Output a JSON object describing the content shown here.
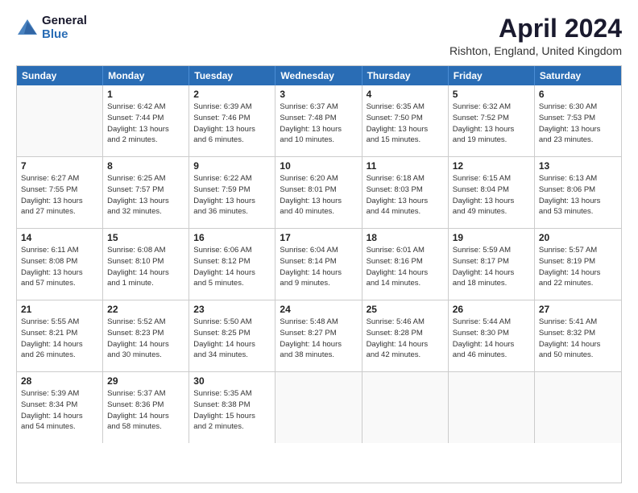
{
  "logo": {
    "general": "General",
    "blue": "Blue"
  },
  "title": "April 2024",
  "location": "Rishton, England, United Kingdom",
  "days_of_week": [
    "Sunday",
    "Monday",
    "Tuesday",
    "Wednesday",
    "Thursday",
    "Friday",
    "Saturday"
  ],
  "weeks": [
    [
      {
        "day": "",
        "info": ""
      },
      {
        "day": "1",
        "info": "Sunrise: 6:42 AM\nSunset: 7:44 PM\nDaylight: 13 hours\nand 2 minutes."
      },
      {
        "day": "2",
        "info": "Sunrise: 6:39 AM\nSunset: 7:46 PM\nDaylight: 13 hours\nand 6 minutes."
      },
      {
        "day": "3",
        "info": "Sunrise: 6:37 AM\nSunset: 7:48 PM\nDaylight: 13 hours\nand 10 minutes."
      },
      {
        "day": "4",
        "info": "Sunrise: 6:35 AM\nSunset: 7:50 PM\nDaylight: 13 hours\nand 15 minutes."
      },
      {
        "day": "5",
        "info": "Sunrise: 6:32 AM\nSunset: 7:52 PM\nDaylight: 13 hours\nand 19 minutes."
      },
      {
        "day": "6",
        "info": "Sunrise: 6:30 AM\nSunset: 7:53 PM\nDaylight: 13 hours\nand 23 minutes."
      }
    ],
    [
      {
        "day": "7",
        "info": "Sunrise: 6:27 AM\nSunset: 7:55 PM\nDaylight: 13 hours\nand 27 minutes."
      },
      {
        "day": "8",
        "info": "Sunrise: 6:25 AM\nSunset: 7:57 PM\nDaylight: 13 hours\nand 32 minutes."
      },
      {
        "day": "9",
        "info": "Sunrise: 6:22 AM\nSunset: 7:59 PM\nDaylight: 13 hours\nand 36 minutes."
      },
      {
        "day": "10",
        "info": "Sunrise: 6:20 AM\nSunset: 8:01 PM\nDaylight: 13 hours\nand 40 minutes."
      },
      {
        "day": "11",
        "info": "Sunrise: 6:18 AM\nSunset: 8:03 PM\nDaylight: 13 hours\nand 44 minutes."
      },
      {
        "day": "12",
        "info": "Sunrise: 6:15 AM\nSunset: 8:04 PM\nDaylight: 13 hours\nand 49 minutes."
      },
      {
        "day": "13",
        "info": "Sunrise: 6:13 AM\nSunset: 8:06 PM\nDaylight: 13 hours\nand 53 minutes."
      }
    ],
    [
      {
        "day": "14",
        "info": "Sunrise: 6:11 AM\nSunset: 8:08 PM\nDaylight: 13 hours\nand 57 minutes."
      },
      {
        "day": "15",
        "info": "Sunrise: 6:08 AM\nSunset: 8:10 PM\nDaylight: 14 hours\nand 1 minute."
      },
      {
        "day": "16",
        "info": "Sunrise: 6:06 AM\nSunset: 8:12 PM\nDaylight: 14 hours\nand 5 minutes."
      },
      {
        "day": "17",
        "info": "Sunrise: 6:04 AM\nSunset: 8:14 PM\nDaylight: 14 hours\nand 9 minutes."
      },
      {
        "day": "18",
        "info": "Sunrise: 6:01 AM\nSunset: 8:16 PM\nDaylight: 14 hours\nand 14 minutes."
      },
      {
        "day": "19",
        "info": "Sunrise: 5:59 AM\nSunset: 8:17 PM\nDaylight: 14 hours\nand 18 minutes."
      },
      {
        "day": "20",
        "info": "Sunrise: 5:57 AM\nSunset: 8:19 PM\nDaylight: 14 hours\nand 22 minutes."
      }
    ],
    [
      {
        "day": "21",
        "info": "Sunrise: 5:55 AM\nSunset: 8:21 PM\nDaylight: 14 hours\nand 26 minutes."
      },
      {
        "day": "22",
        "info": "Sunrise: 5:52 AM\nSunset: 8:23 PM\nDaylight: 14 hours\nand 30 minutes."
      },
      {
        "day": "23",
        "info": "Sunrise: 5:50 AM\nSunset: 8:25 PM\nDaylight: 14 hours\nand 34 minutes."
      },
      {
        "day": "24",
        "info": "Sunrise: 5:48 AM\nSunset: 8:27 PM\nDaylight: 14 hours\nand 38 minutes."
      },
      {
        "day": "25",
        "info": "Sunrise: 5:46 AM\nSunset: 8:28 PM\nDaylight: 14 hours\nand 42 minutes."
      },
      {
        "day": "26",
        "info": "Sunrise: 5:44 AM\nSunset: 8:30 PM\nDaylight: 14 hours\nand 46 minutes."
      },
      {
        "day": "27",
        "info": "Sunrise: 5:41 AM\nSunset: 8:32 PM\nDaylight: 14 hours\nand 50 minutes."
      }
    ],
    [
      {
        "day": "28",
        "info": "Sunrise: 5:39 AM\nSunset: 8:34 PM\nDaylight: 14 hours\nand 54 minutes."
      },
      {
        "day": "29",
        "info": "Sunrise: 5:37 AM\nSunset: 8:36 PM\nDaylight: 14 hours\nand 58 minutes."
      },
      {
        "day": "30",
        "info": "Sunrise: 5:35 AM\nSunset: 8:38 PM\nDaylight: 15 hours\nand 2 minutes."
      },
      {
        "day": "",
        "info": ""
      },
      {
        "day": "",
        "info": ""
      },
      {
        "day": "",
        "info": ""
      },
      {
        "day": "",
        "info": ""
      }
    ]
  ]
}
